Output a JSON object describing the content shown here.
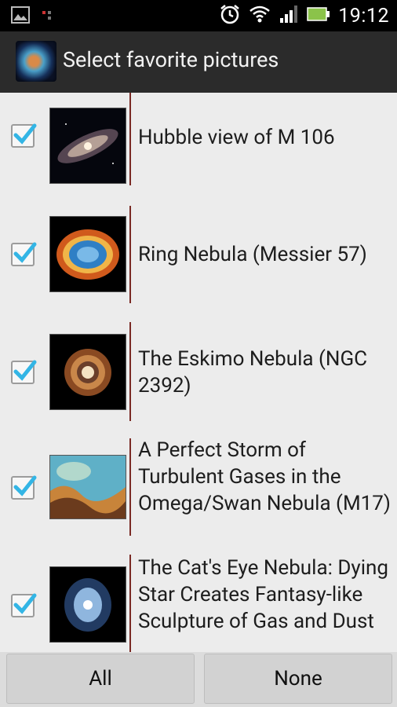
{
  "status_bar": {
    "time": "19:12",
    "icons_left": [
      "image-icon",
      "sim-icon"
    ],
    "icons_right": [
      "alarm-icon",
      "wifi-icon",
      "signal-icon",
      "battery-icon"
    ]
  },
  "action_bar": {
    "app_icon": "crab-nebula-app-icon",
    "title": "Select favorite pictures"
  },
  "pictures": [
    {
      "label": "Hubble view of M 106",
      "checked": true,
      "thumb": "galaxy"
    },
    {
      "label": "Ring Nebula (Messier 57)",
      "checked": true,
      "thumb": "ring"
    },
    {
      "label": "The Eskimo Nebula (NGC 2392)",
      "checked": true,
      "thumb": "eskimo"
    },
    {
      "label": "A Perfect Storm of Turbulent Gases in the Omega/Swan Nebula (M17)",
      "checked": true,
      "thumb": "storm"
    },
    {
      "label": "The Cat's Eye Nebula: Dying Star Creates Fantasy-like Sculpture of Gas and Dust",
      "checked": true,
      "thumb": "catseye"
    }
  ],
  "buttons": {
    "all_label": "All",
    "none_label": "None"
  },
  "colors": {
    "status_bar": "#000000",
    "action_bar": "#2b2b2b",
    "check_accent": "#33b5e5",
    "divider": "#7a2a24"
  }
}
